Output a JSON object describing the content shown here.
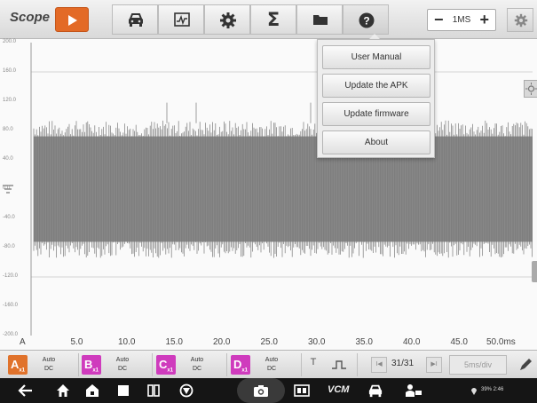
{
  "app": {
    "logo": "Scope"
  },
  "toolbar": {
    "buttons": [
      {
        "name": "car-icon"
      },
      {
        "name": "waveform-library-icon"
      },
      {
        "name": "gear-icon"
      },
      {
        "name": "sigma-math-button",
        "label": "Σ"
      },
      {
        "name": "folder-icon"
      },
      {
        "name": "help-icon"
      }
    ],
    "timebase_value": "1MS",
    "minus_label": "−",
    "plus_label": "+"
  },
  "help_menu": {
    "items": [
      "User Manual",
      "Update the APK",
      "Update firmware",
      "About"
    ]
  },
  "plot": {
    "y_ticks": [
      "200.0",
      "160.0",
      "120.0",
      "80.0",
      "40.0",
      "0.0",
      "-40.0",
      "-80.0",
      "-120.0",
      "-160.0",
      "-200.0"
    ],
    "x_ticks": [
      "5.0",
      "10.0",
      "15.0",
      "20.0",
      "25.0",
      "30.0",
      "35.0",
      "40.0",
      "45.0",
      "50.0ms"
    ],
    "channel_marker": "A"
  },
  "channels": [
    {
      "letter": "A",
      "sub": "x1",
      "mode_line1": "Auto",
      "mode_line2": "DC",
      "color": "#e0722b"
    },
    {
      "letter": "B",
      "sub": "x1",
      "mode_line1": "Auto",
      "mode_line2": "DC",
      "color": "#cf3bbd"
    },
    {
      "letter": "C",
      "sub": "x1",
      "mode_line1": "Auto",
      "mode_line2": "DC",
      "color": "#cf3bbd"
    },
    {
      "letter": "D",
      "sub": "x1",
      "mode_line1": "Auto",
      "mode_line2": "DC",
      "color": "#cf3bbd"
    }
  ],
  "channel_bar": {
    "trigger_label": "T",
    "page_counter": "31/31",
    "prev_label": "I◀",
    "next_label": "▶I",
    "timediv": "5ms/div"
  },
  "navbar": {
    "vcm_label": "VCM",
    "status_text": "39% 2:46"
  },
  "colors": {
    "accent": "#e36a26",
    "waveform": "#7a7a7a"
  }
}
